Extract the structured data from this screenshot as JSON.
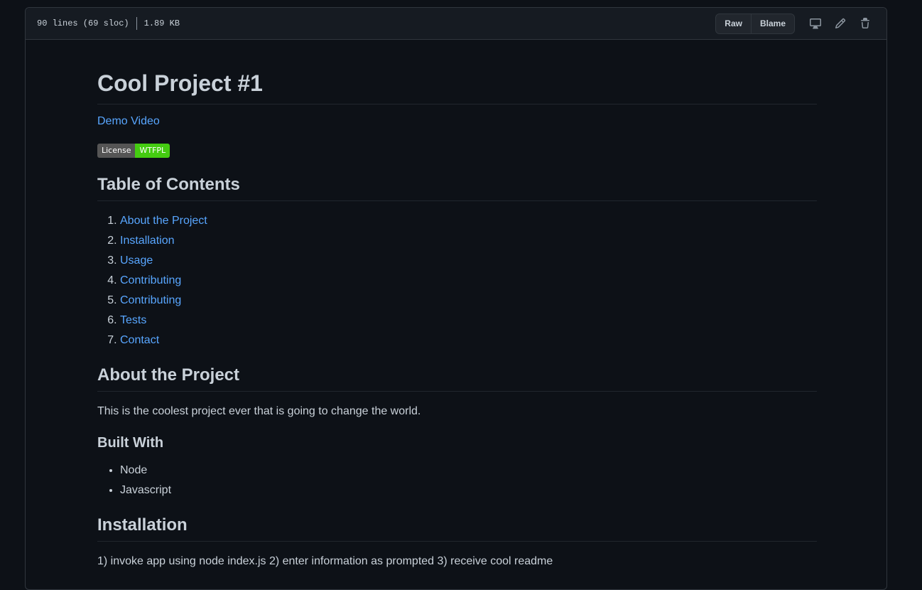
{
  "file_header": {
    "lines": "90 lines (69 sloc)",
    "size": "1.89 KB",
    "raw_label": "Raw",
    "blame_label": "Blame",
    "icons": [
      "desktop-icon",
      "pencil-icon",
      "trash-icon"
    ]
  },
  "readme": {
    "title": "Cool Project #1",
    "demo_link": "Demo Video",
    "badge": {
      "label": "License",
      "value": "WTFPL",
      "color": "#44cc11"
    },
    "toc_heading": "Table of Contents",
    "toc": [
      "About the Project",
      "Installation",
      "Usage",
      "Contributing",
      "Contributing",
      "Tests",
      "Contact"
    ],
    "about_heading": "About the Project",
    "about_text": "This is the coolest project ever that is going to change the world.",
    "built_with_heading": "Built With",
    "built_with": [
      "Node",
      "Javascript"
    ],
    "installation_heading": "Installation",
    "installation_text": "1) invoke app using node index.js 2) enter information as prompted 3) receive cool readme"
  },
  "colors": {
    "background": "#0d1117",
    "header_background": "#161b22",
    "link": "#58a6ff",
    "text": "#c9d1d9",
    "border": "#30363d"
  }
}
